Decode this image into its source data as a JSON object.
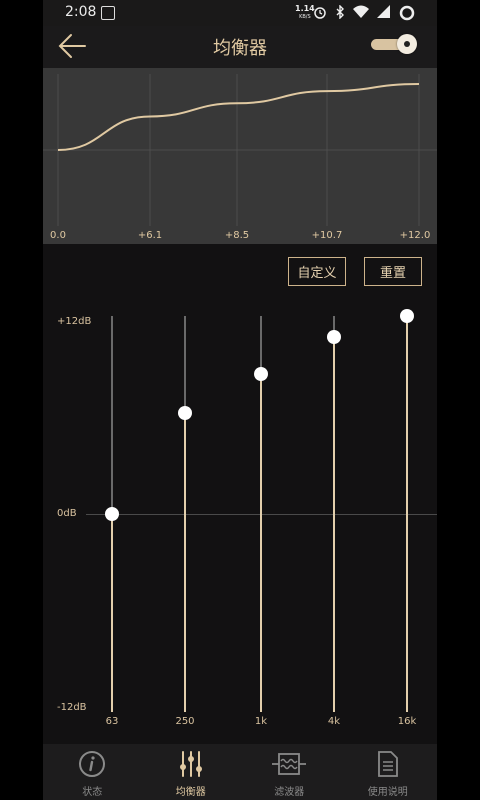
{
  "status_bar": {
    "time": "2:08",
    "net_speed": "1.14",
    "net_unit": "KB/S"
  },
  "header": {
    "title": "均衡器",
    "toggle_on": true
  },
  "curve": {
    "x_labels": [
      "0.0",
      "+6.1",
      "+8.5",
      "+10.7",
      "+12.0"
    ],
    "values": [
      0.0,
      6.1,
      8.5,
      10.7,
      12.0
    ]
  },
  "actions": {
    "custom_label": "自定义",
    "reset_label": "重置"
  },
  "eq": {
    "top_label": "+12dB",
    "zero_label": "0dB",
    "bottom_label": "-12dB",
    "max_db": 12,
    "min_db": -12,
    "bands": [
      {
        "freq": "63",
        "gain": 0.0
      },
      {
        "freq": "250",
        "gain": 6.1
      },
      {
        "freq": "1k",
        "gain": 8.5
      },
      {
        "freq": "4k",
        "gain": 10.7
      },
      {
        "freq": "16k",
        "gain": 12.0
      }
    ]
  },
  "nav": {
    "items": [
      {
        "label": "状态",
        "active": false
      },
      {
        "label": "均衡器",
        "active": true
      },
      {
        "label": "滤波器",
        "active": false
      },
      {
        "label": "使用说明",
        "active": false
      }
    ]
  },
  "colors": {
    "accent": "#e0c9a2",
    "background": "#121112",
    "panel": "#383838"
  }
}
